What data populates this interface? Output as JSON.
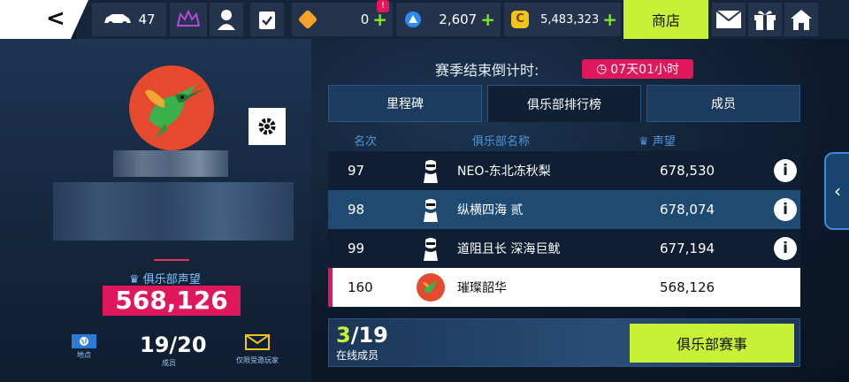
{
  "topbar": {
    "back_label": "<",
    "cars_count": "47",
    "currency_1": "0",
    "currency_2": "2,607",
    "currency_3": "5,483,323",
    "plus": "+",
    "shop_label": "商店"
  },
  "club": {
    "reputation_label": "俱乐部声望",
    "reputation_value": "568,126",
    "members_value": "19/20",
    "location_label": "地点",
    "members_label": "成员",
    "invite_label": "仅限受邀玩家"
  },
  "season": {
    "countdown_label": "赛季结束倒计时:",
    "countdown_value": "07天01小时"
  },
  "tabs": [
    {
      "label": "里程碑"
    },
    {
      "label": "俱乐部排行榜"
    },
    {
      "label": "成员"
    }
  ],
  "columns": {
    "rank": "名次",
    "club_name": "俱乐部名称",
    "reputation": "声望"
  },
  "leaderboard": [
    {
      "rank": "97",
      "name": "NEO-东北冻秋梨",
      "score": "678,530",
      "info": "i"
    },
    {
      "rank": "98",
      "name": "纵横四海 贰",
      "score": "678,074",
      "info": "i"
    },
    {
      "rank": "99",
      "name": "道阻且长 深海巨鱿",
      "score": "677,194",
      "info": "i"
    },
    {
      "rank": "160",
      "name": "璀璨韶华",
      "score": "568,126"
    }
  ],
  "online": {
    "current": "3",
    "total": "/19",
    "label": "在线成员"
  },
  "event_button": "俱乐部赛事",
  "colors": {
    "accent_green": "#c8f035",
    "accent_pink": "#e0175a",
    "panel_blue": "#1f4a72"
  }
}
